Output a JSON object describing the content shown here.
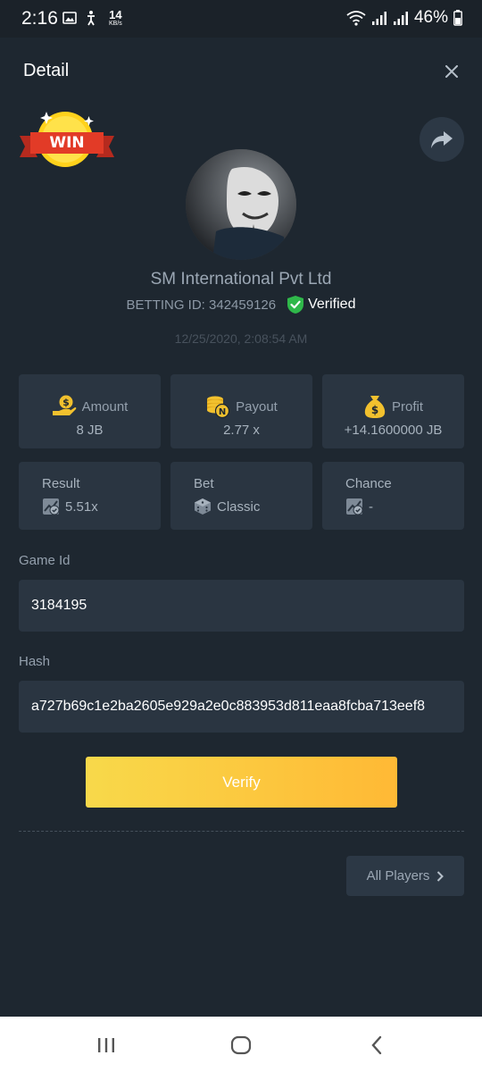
{
  "status_bar": {
    "time": "2:16",
    "speed_value": "14",
    "speed_unit": "KB/s",
    "battery": "46%"
  },
  "header": {
    "title": "Detail"
  },
  "badge": {
    "text": "WIN"
  },
  "profile": {
    "company": "SM International Pvt Ltd",
    "betting_id": "BETTING ID: 342459126",
    "verified_label": "Verified",
    "timestamp": "12/25/2020, 2:08:54 AM"
  },
  "stats": [
    {
      "label": "Amount",
      "value": "8 JB",
      "icon": "money-hand-icon"
    },
    {
      "label": "Payout",
      "value": "2.77 x",
      "icon": "coins-stack-icon"
    },
    {
      "label": "Profit",
      "value": "+14.1600000 JB",
      "icon": "money-bag-icon"
    }
  ],
  "info": [
    {
      "label": "Result",
      "value": "5.51x",
      "icon": "crash-chart-icon"
    },
    {
      "label": "Bet",
      "value": "Classic",
      "icon": "dice-icon"
    },
    {
      "label": "Chance",
      "value": "-",
      "icon": "crash-chart-icon"
    }
  ],
  "game_id": {
    "label": "Game Id",
    "value": "3184195"
  },
  "hash": {
    "label": "Hash",
    "value": "a727b69c1e2ba2605e929a2e0c883953d811eaa8fcba713eef8"
  },
  "verify_button": "Verify",
  "all_players_button": "All Players",
  "colors": {
    "background": "#1e2730",
    "card": "#2a3541",
    "accent_gold": "#ffc83a",
    "verified_green": "#2fb84a"
  }
}
